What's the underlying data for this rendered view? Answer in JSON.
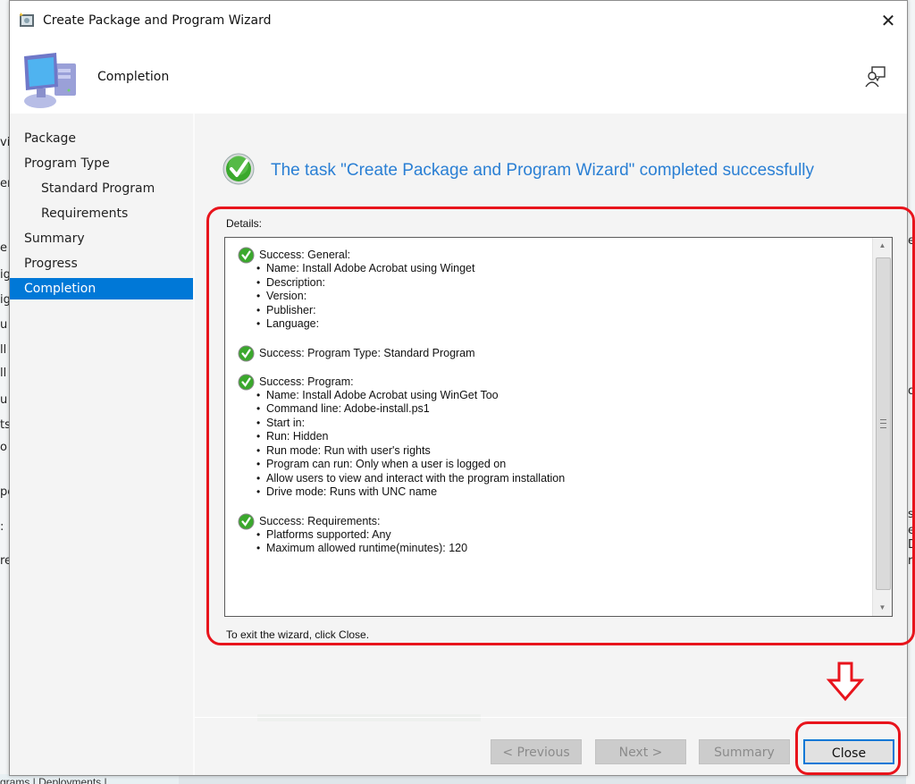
{
  "background": {
    "left_fragments": [
      "vi",
      "er",
      "e",
      "ig",
      "ig",
      "u",
      "ll",
      "ll",
      "u",
      "ts",
      "o",
      "pe",
      ":",
      "re"
    ],
    "right_fragments": [
      "e",
      "o",
      "s",
      "e",
      "D",
      "r"
    ],
    "bottom_tabs": "grams | Deployments |"
  },
  "window": {
    "title": "Create Package and Program Wizard",
    "close_glyph": "✕"
  },
  "header": {
    "page_title": "Completion",
    "help_icon": "user-feedback-icon"
  },
  "sidebar": {
    "items": [
      {
        "label": "Package",
        "level": 0,
        "active": false
      },
      {
        "label": "Program Type",
        "level": 0,
        "active": false
      },
      {
        "label": "Standard Program",
        "level": 1,
        "active": false
      },
      {
        "label": "Requirements",
        "level": 1,
        "active": false
      },
      {
        "label": "Summary",
        "level": 0,
        "active": false
      },
      {
        "label": "Progress",
        "level": 0,
        "active": false
      },
      {
        "label": "Completion",
        "level": 0,
        "active": true
      }
    ]
  },
  "content": {
    "status_message": "The task \"Create Package and Program Wizard\" completed successfully",
    "details_label": "Details:",
    "sections": [
      {
        "heading": "Success: General:",
        "items": [
          "Name: Install Adobe Acrobat using Winget",
          "Description:",
          "Version:",
          "Publisher:",
          "Language:"
        ]
      },
      {
        "heading": "Success: Program Type: Standard Program",
        "items": []
      },
      {
        "heading": "Success: Program:",
        "items": [
          "Name: Install Adobe Acrobat using WinGet Too",
          "Command line: Adobe-install.ps1",
          "Start in:",
          "Run: Hidden",
          "Run mode: Run with user's rights",
          "Program can run: Only when a user is logged on",
          "Allow users to view and interact with the program installation",
          "Drive mode: Runs with UNC name"
        ]
      },
      {
        "heading": "Success: Requirements:",
        "items": [
          "Platforms supported: Any",
          "Maximum allowed runtime(minutes): 120"
        ]
      }
    ],
    "exit_instructions": "To exit the wizard, click Close."
  },
  "buttons": {
    "previous": "< Previous",
    "next": "Next >",
    "summary": "Summary",
    "close": "Close"
  },
  "colors": {
    "accent": "#0078d7",
    "status_text": "#2a7fd4",
    "annotation": "#e8141c"
  }
}
